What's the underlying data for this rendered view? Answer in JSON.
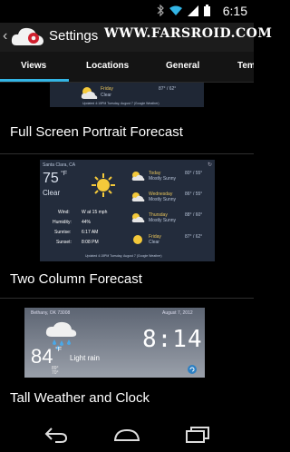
{
  "status_bar": {
    "time": "6:15",
    "icons": [
      "bluetooth-icon",
      "wifi-icon",
      "signal-icon",
      "battery-icon"
    ]
  },
  "action_bar": {
    "title": "Settings",
    "watermark": "WWW.FARSROID.COM"
  },
  "tabs": [
    {
      "label": "Views",
      "selected": true
    },
    {
      "label": "Locations",
      "selected": false
    },
    {
      "label": "General",
      "selected": false
    },
    {
      "label": "Tem",
      "selected": false
    }
  ],
  "accent_color": "#33b5e5",
  "items": [
    {
      "label": "Full Screen Portrait Forecast",
      "preview": {
        "day": "Friday",
        "condition": "Clear",
        "temps": "87° / 62°",
        "footer": "Updated 4:15PM Tuesday, August 7 (Google Weather)"
      }
    },
    {
      "label": "Two Column Forecast",
      "preview": {
        "city": "Santa Clara, CA",
        "temp": "75",
        "temp_unit": "°F",
        "condition": "Clear",
        "details": [
          {
            "k": "Wind:",
            "v": "W at 15 mph"
          },
          {
            "k": "Humidity:",
            "v": "44%"
          },
          {
            "k": "Sunrise:",
            "v": "6:17 AM"
          },
          {
            "k": "Sunset:",
            "v": "8:08 PM"
          }
        ],
        "forecast": [
          {
            "day": "Today",
            "cond": "Mostly Sunny",
            "temps": "80° / 55°"
          },
          {
            "day": "Wednesday",
            "cond": "Mostly Sunny",
            "temps": "86° / 55°"
          },
          {
            "day": "Thursday",
            "cond": "Mostly Sunny",
            "temps": "88° / 60°"
          },
          {
            "day": "Friday",
            "cond": "Clear",
            "temps": "87° / 62°"
          }
        ],
        "footer": "Updated 4:15PM Tuesday, August 7 (Google Weather)"
      }
    },
    {
      "label": "Tall Weather and Clock",
      "preview": {
        "city": "Bethany, OK 73008",
        "date": "August 7, 2012",
        "temp": "84",
        "temp_unit": "°F",
        "condition": "Light rain",
        "hi": "89°",
        "lo": "70°",
        "time": "8:14"
      }
    }
  ]
}
